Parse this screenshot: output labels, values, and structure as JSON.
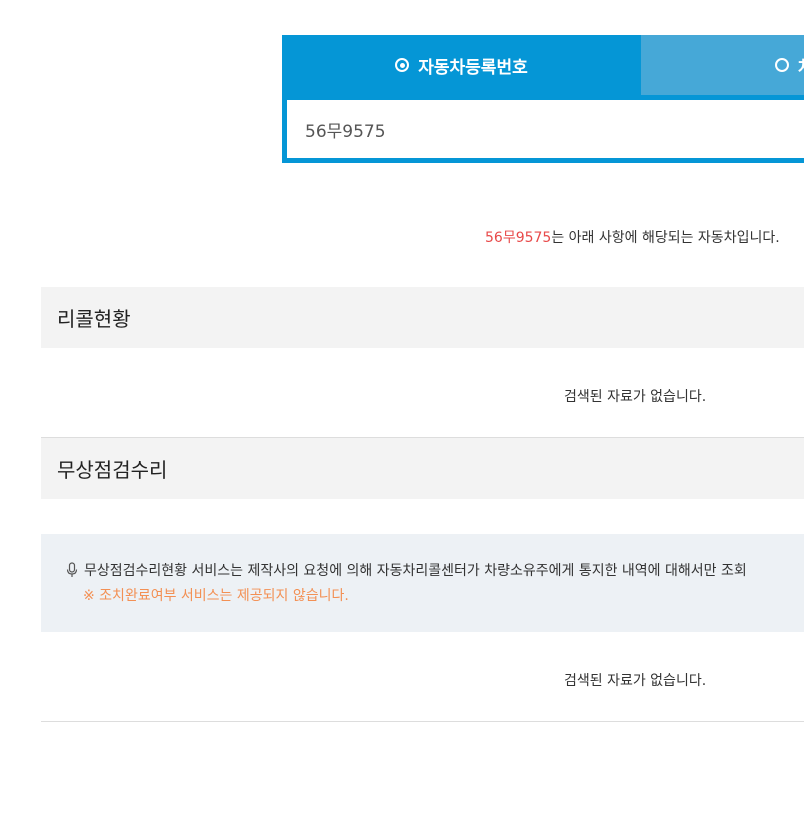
{
  "search": {
    "tab_plate_label": "자동차등록번호",
    "tab_other_label": "차",
    "plate_value": "56무9575"
  },
  "result": {
    "plate": "56무9575",
    "message_suffix": "는 아래 사항에 해당되는 자동차입니다."
  },
  "recall": {
    "title": "리콜현황",
    "empty_message": "검색된 자료가 없습니다."
  },
  "free_repair": {
    "title": "무상점검수리",
    "notice_line1": "무상점검수리현황 서비스는 제작사의 요청에 의해 자동차리콜센터가 차량소유주에게 통지한 내역에 대해서만 조회",
    "notice_line2": "※ 조치완료여부 서비스는 제공되지 않습니다.",
    "empty_message": "검색된 자료가 없습니다."
  },
  "colors": {
    "tab_active": "#0596d6",
    "tab_inactive": "#46a8d7",
    "plate_highlight": "#e84a4a",
    "notice_warning": "#f39054",
    "notice_bg": "#edf1f5"
  },
  "icons": {
    "tab_radio_selected": "radio-selected-icon",
    "tab_radio_unselected": "radio-unselected-icon",
    "notice": "microphone-icon"
  }
}
